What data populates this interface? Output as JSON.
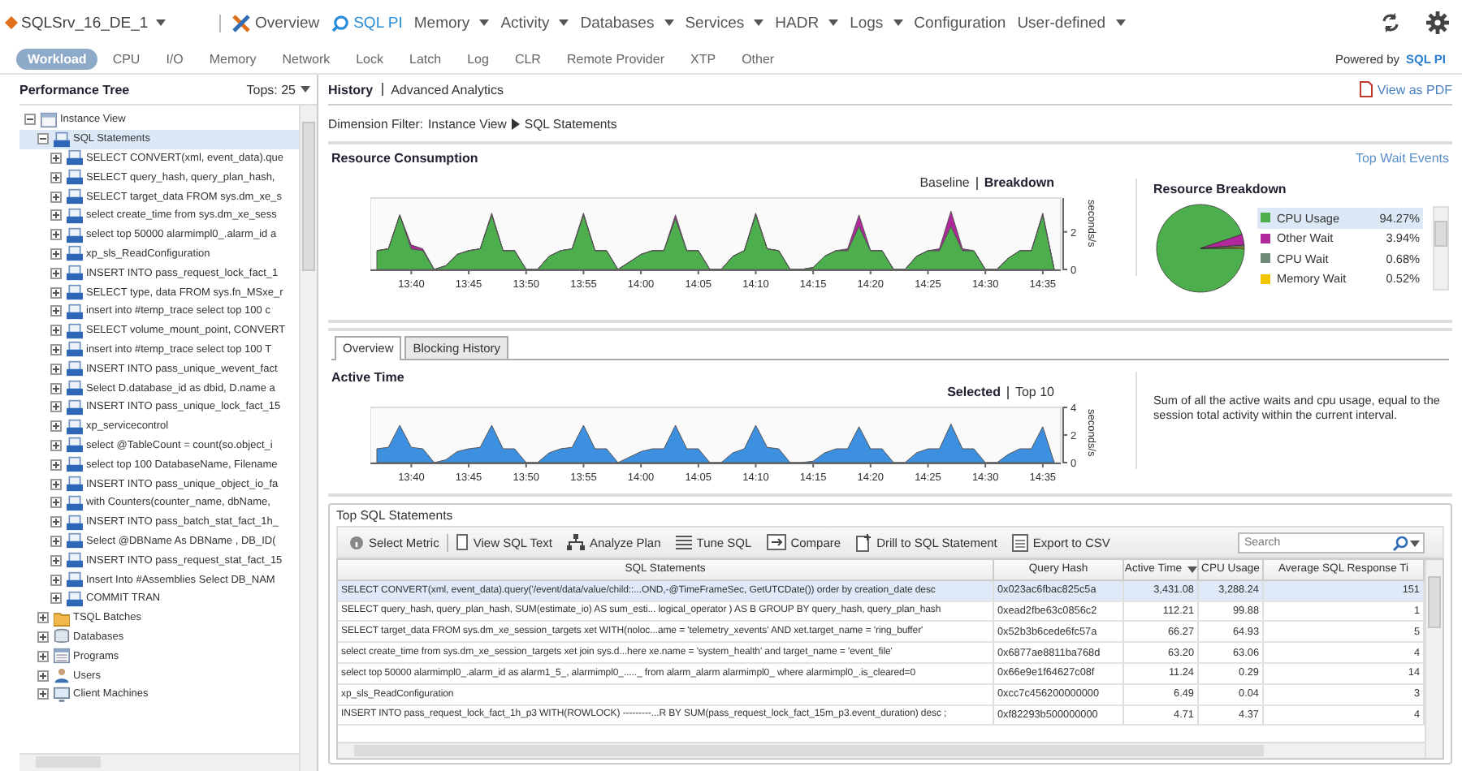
{
  "server": {
    "label": "SQLSrv_16_DE_1"
  },
  "nav": [
    {
      "label": "Overview",
      "kind": "overview",
      "dropdown": false,
      "selected": false
    },
    {
      "label": "SQL PI",
      "kind": "search",
      "dropdown": false,
      "selected": true
    },
    {
      "label": "Memory",
      "kind": "plain",
      "dropdown": true,
      "selected": false
    },
    {
      "label": "Activity",
      "kind": "plain",
      "dropdown": true,
      "selected": false
    },
    {
      "label": "Databases",
      "kind": "plain",
      "dropdown": true,
      "selected": false
    },
    {
      "label": "Services",
      "kind": "plain",
      "dropdown": true,
      "selected": false
    },
    {
      "label": "HADR",
      "kind": "plain",
      "dropdown": true,
      "selected": false
    },
    {
      "label": "Logs",
      "kind": "plain",
      "dropdown": true,
      "selected": false
    },
    {
      "label": "Configuration",
      "kind": "plain",
      "dropdown": false,
      "selected": false
    },
    {
      "label": "User-defined",
      "kind": "plain",
      "dropdown": true,
      "selected": false
    }
  ],
  "tabs": [
    {
      "label": "Workload",
      "selected": true
    },
    {
      "label": "CPU",
      "selected": false
    },
    {
      "label": "I/O",
      "selected": false
    },
    {
      "label": "Memory",
      "selected": false
    },
    {
      "label": "Network",
      "selected": false
    },
    {
      "label": "Lock",
      "selected": false
    },
    {
      "label": "Latch",
      "selected": false
    },
    {
      "label": "Log",
      "selected": false
    },
    {
      "label": "CLR",
      "selected": false
    },
    {
      "label": "Remote Provider",
      "selected": false
    },
    {
      "label": "XTP",
      "selected": false
    },
    {
      "label": "Other",
      "selected": false
    }
  ],
  "powered_by": {
    "label": "Powered by",
    "logo": "SQL PI"
  },
  "tree_panel": {
    "title": "Performance Tree",
    "tops": "Tops: 25"
  },
  "tree": [
    {
      "label": "Instance View",
      "kind": "instance",
      "expanded": true,
      "selected": false,
      "children": [
        {
          "label": "SQL Statements",
          "kind": "sql",
          "expanded": true,
          "selected": true,
          "children": [
            {
              "label": "SELECT CONVERT(xml, event_data).que",
              "kind": "sql",
              "expanded": false,
              "selected": false
            },
            {
              "label": "SELECT query_hash, query_plan_hash,",
              "kind": "sql",
              "expanded": false,
              "selected": false
            },
            {
              "label": "SELECT target_data FROM sys.dm_xe_s",
              "kind": "sql",
              "expanded": false,
              "selected": false
            },
            {
              "label": "select create_time from sys.dm_xe_sess",
              "kind": "sql",
              "expanded": false,
              "selected": false
            },
            {
              "label": "select top 50000 alarmimpl0_.alarm_id a",
              "kind": "sql",
              "expanded": false,
              "selected": false
            },
            {
              "label": "xp_sls_ReadConfiguration",
              "kind": "sql",
              "expanded": false,
              "selected": false
            },
            {
              "label": "INSERT INTO pass_request_lock_fact_1",
              "kind": "sql",
              "expanded": false,
              "selected": false
            },
            {
              "label": "SELECT type, data FROM sys.fn_MSxe_r",
              "kind": "sql",
              "expanded": false,
              "selected": false
            },
            {
              "label": "insert into #temp_trace select top 100 c",
              "kind": "sql",
              "expanded": false,
              "selected": false
            },
            {
              "label": "SELECT volume_mount_point, CONVERT",
              "kind": "sql",
              "expanded": false,
              "selected": false
            },
            {
              "label": "insert into #temp_trace select top 100 T",
              "kind": "sql",
              "expanded": false,
              "selected": false
            },
            {
              "label": "INSERT INTO pass_unique_wevent_fact",
              "kind": "sql",
              "expanded": false,
              "selected": false
            },
            {
              "label": "Select D.database_id as dbid, D.name a",
              "kind": "sql",
              "expanded": false,
              "selected": false
            },
            {
              "label": "INSERT INTO pass_unique_lock_fact_15",
              "kind": "sql",
              "expanded": false,
              "selected": false
            },
            {
              "label": "xp_servicecontrol",
              "kind": "sql",
              "expanded": false,
              "selected": false
            },
            {
              "label": "select @TableCount = count(so.object_i",
              "kind": "sql",
              "expanded": false,
              "selected": false
            },
            {
              "label": "select top 100 DatabaseName, Filename",
              "kind": "sql",
              "expanded": false,
              "selected": false
            },
            {
              "label": "INSERT INTO pass_unique_object_io_fa",
              "kind": "sql",
              "expanded": false,
              "selected": false
            },
            {
              "label": "with Counters(counter_name, dbName,",
              "kind": "sql",
              "expanded": false,
              "selected": false
            },
            {
              "label": "INSERT INTO pass_batch_stat_fact_1h_",
              "kind": "sql",
              "expanded": false,
              "selected": false
            },
            {
              "label": "Select @DBName As DBName , DB_ID(",
              "kind": "sql",
              "expanded": false,
              "selected": false
            },
            {
              "label": "INSERT INTO pass_request_stat_fact_15",
              "kind": "sql",
              "expanded": false,
              "selected": false
            },
            {
              "label": "Insert Into #Assemblies Select DB_NAM",
              "kind": "sql",
              "expanded": false,
              "selected": false
            },
            {
              "label": "COMMIT TRAN",
              "kind": "sql",
              "expanded": false,
              "selected": false
            }
          ]
        },
        {
          "label": "TSQL Batches",
          "kind": "batch",
          "expanded": false,
          "selected": false
        },
        {
          "label": "Databases",
          "kind": "database",
          "expanded": false,
          "selected": false
        },
        {
          "label": "Programs",
          "kind": "program",
          "expanded": false,
          "selected": false
        },
        {
          "label": "Users",
          "kind": "user",
          "expanded": false,
          "selected": false
        },
        {
          "label": "Client Machines",
          "kind": "machine",
          "expanded": false,
          "selected": false
        }
      ]
    }
  ],
  "view_tabs": [
    {
      "label": "History",
      "selected": true
    },
    {
      "label": "Advanced Analytics",
      "selected": false
    }
  ],
  "view_as_pdf": "View as PDF",
  "dimension_filter": {
    "label": "Dimension Filter:",
    "path": [
      "Instance View",
      "SQL Statements"
    ]
  },
  "resource_consumption": {
    "title": "Resource Consumption",
    "link": "Top Wait Events",
    "toggles": [
      {
        "label": "Baseline",
        "selected": false
      },
      {
        "label": "Breakdown",
        "selected": true
      }
    ],
    "chart_data": {
      "type": "area",
      "ylabel": "seconds/s",
      "stacked": true,
      "ylim": [
        0,
        3.8
      ],
      "yticks": [
        0,
        2
      ],
      "categories": [
        null,
        null,
        null,
        "13:40",
        null,
        null,
        null,
        null,
        "13:45",
        null,
        null,
        null,
        null,
        "13:50",
        null,
        null,
        null,
        null,
        "13:55",
        null,
        null,
        null,
        null,
        "14:00",
        null,
        null,
        null,
        null,
        "14:05",
        null,
        null,
        null,
        null,
        "14:10",
        null,
        null,
        null,
        null,
        "14:15",
        null,
        null,
        null,
        null,
        "14:20",
        null,
        null,
        null,
        null,
        "14:25",
        null,
        null,
        null,
        null,
        "14:30",
        null,
        null,
        null,
        null,
        "14:35",
        null
      ],
      "series": [
        {
          "color": "#4cae4c",
          "values": [
            1.0,
            1.1,
            2.9,
            1.1,
            1.0,
            0.0,
            0.2,
            0.8,
            1.0,
            1.1,
            2.9,
            1.0,
            1.0,
            0.0,
            0.0,
            0.7,
            1.0,
            1.1,
            2.9,
            1.0,
            1.0,
            0.0,
            0.4,
            0.8,
            1.0,
            1.0,
            2.7,
            1.0,
            1.0,
            0.0,
            0.0,
            0.7,
            1.0,
            2.9,
            1.1,
            1.0,
            0.0,
            0.0,
            0.1,
            0.7,
            1.0,
            1.0,
            2.3,
            1.0,
            1.0,
            0.0,
            0.0,
            0.7,
            1.0,
            1.0,
            2.3,
            1.0,
            1.0,
            0.0,
            0.0,
            0.6,
            1.0,
            1.0,
            2.9,
            0.0
          ]
        },
        {
          "color": "#b0289c",
          "values": [
            0,
            0,
            0,
            0.2,
            0.1,
            0,
            0,
            0,
            0,
            0,
            0.1,
            0,
            0,
            0,
            0,
            0,
            0,
            0,
            0.1,
            0,
            0,
            0,
            0,
            0,
            0,
            0,
            0.2,
            0,
            0,
            0,
            0,
            0,
            0,
            0.1,
            0,
            0,
            0,
            0,
            0,
            0,
            0,
            0.1,
            0.6,
            0,
            0,
            0,
            0,
            0,
            0,
            0.1,
            0.8,
            0.1,
            0,
            0,
            0,
            0,
            0,
            0,
            0.1,
            0
          ]
        }
      ]
    }
  },
  "resource_breakdown": {
    "title": "Resource Breakdown",
    "legend": [
      {
        "percent": "94.27%",
        "color": "#4cae4c",
        "selected": true
      },
      {
        "percent": "3.94%",
        "color": "#b0289c",
        "selected": false
      },
      {
        "percent": "0.68%",
        "color": "#6f8a78",
        "selected": false
      },
      {
        "percent": "0.52%",
        "color": "#f2c500",
        "selected": false
      }
    ],
    "chart_data": {
      "type": "pie",
      "categories": [
        "CPU Usage",
        "Other Wait",
        "CPU Wait",
        "Memory Wait"
      ],
      "values": [
        94.27,
        3.94,
        0.68,
        0.52
      ]
    }
  },
  "detail_tabs": [
    {
      "label": "Overview",
      "selected": true
    },
    {
      "label": "Blocking History",
      "selected": false
    }
  ],
  "active_time": {
    "title": "Active Time",
    "toggles": [
      {
        "label": "Selected",
        "selected": true
      },
      {
        "label": "Top 10",
        "selected": false
      }
    ],
    "description": "Sum of all the active waits and cpu usage, equal to the session total activity within the current interval.",
    "chart_data": {
      "type": "area",
      "ylabel": "seconds/s",
      "ylim": [
        0,
        4
      ],
      "yticks": [
        0,
        2,
        4
      ],
      "categories": [
        null,
        null,
        null,
        "13:40",
        null,
        null,
        null,
        null,
        "13:45",
        null,
        null,
        null,
        null,
        "13:50",
        null,
        null,
        null,
        null,
        "13:55",
        null,
        null,
        null,
        null,
        "14:00",
        null,
        null,
        null,
        null,
        "14:05",
        null,
        null,
        null,
        null,
        "14:10",
        null,
        null,
        null,
        null,
        "14:15",
        null,
        null,
        null,
        null,
        "14:20",
        null,
        null,
        null,
        null,
        "14:25",
        null,
        null,
        null,
        null,
        "14:30",
        null,
        null,
        null,
        null,
        "14:35",
        null
      ],
      "series": [
        {
          "color": "#3d8fe0",
          "values": [
            1.0,
            1.1,
            2.7,
            1.1,
            1.0,
            0.0,
            0.2,
            0.8,
            1.0,
            1.1,
            2.7,
            1.0,
            1.0,
            0.0,
            0.0,
            0.7,
            1.0,
            1.1,
            2.7,
            1.0,
            1.0,
            0.0,
            0.4,
            0.8,
            1.0,
            1.0,
            2.7,
            1.0,
            1.0,
            0.0,
            0.0,
            0.7,
            1.0,
            2.7,
            1.1,
            1.0,
            0.0,
            0.0,
            0.1,
            0.7,
            1.0,
            1.0,
            2.6,
            1.0,
            1.0,
            0.0,
            0.0,
            0.7,
            1.0,
            1.0,
            2.8,
            1.0,
            1.0,
            0.0,
            0.0,
            0.6,
            1.0,
            1.0,
            2.6,
            0.0
          ]
        }
      ]
    }
  },
  "top_sql": {
    "title": "Top SQL Statements",
    "toolbar": [
      {
        "label": "Select Metric",
        "kind": "metric"
      },
      {
        "label": "View SQL Text",
        "kind": "text"
      },
      {
        "label": "Analyze Plan",
        "kind": "plan"
      },
      {
        "label": "Tune SQL",
        "kind": "tune"
      },
      {
        "label": "Compare",
        "kind": "compare"
      },
      {
        "label": "Drill to SQL Statement",
        "kind": "drill"
      },
      {
        "label": "Export to CSV",
        "kind": "export"
      }
    ],
    "search": {
      "placeholder": "Search"
    },
    "columns": [
      {
        "label": "SQL Statements",
        "sorted": false
      },
      {
        "label": "Query Hash",
        "sorted": false
      },
      {
        "label": "Active Time",
        "sorted": true
      },
      {
        "label": "CPU Usage",
        "sorted": false
      },
      {
        "label": "Average SQL Response Ti",
        "sorted": false
      }
    ],
    "rows": [
      {
        "selected": true,
        "cells": [
          "SELECT CONVERT(xml, event_data).query('/event/data/value/child::...OND,-@TimeFrameSec, GetUTCDate()) order by creation_date desc",
          "0x023ac6fbac825c5a",
          "3,431.08",
          "3,288.24",
          "151"
        ]
      },
      {
        "selected": false,
        "cells": [
          "SELECT query_hash, query_plan_hash, SUM(estimate_io) AS sum_esti... logical_operator ) AS B GROUP BY query_hash, query_plan_hash",
          "0xead2fbe63c0856c2",
          "112.21",
          "99.88",
          "1"
        ]
      },
      {
        "selected": false,
        "cells": [
          "SELECT target_data FROM sys.dm_xe_session_targets xet WITH(noloc...ame = 'telemetry_xevents' AND xet.target_name = 'ring_buffer'",
          "0x52b3b6cede6fc57a",
          "66.27",
          "64.93",
          "5"
        ]
      },
      {
        "selected": false,
        "cells": [
          "select create_time from sys.dm_xe_session_targets xet join sys.d...here xe.name = 'system_health' and target_name = 'event_file'",
          "0x6877ae8811ba768d",
          "63.20",
          "63.06",
          "4"
        ]
      },
      {
        "selected": false,
        "cells": [
          "select top 50000 alarmimpl0_.alarm_id as alarm1_5_, alarmimpl0_....._ from alarm_alarm alarmimpl0_ where alarmimpl0_.is_cleared=0",
          "0x66e9e1f64627c08f",
          "11.24",
          "0.29",
          "14"
        ]
      },
      {
        "selected": false,
        "cells": [
          "xp_sls_ReadConfiguration",
          "0xcc7c456200000000",
          "6.49",
          "0.04",
          "3"
        ]
      },
      {
        "selected": false,
        "cells": [
          "INSERT INTO pass_request_lock_fact_1h_p3 WITH(ROWLOCK) ---------...R BY SUM(pass_request_lock_fact_15m_p3.event_duration) desc ;",
          "0xf82293b500000000",
          "4.71",
          "4.37",
          "4"
        ]
      }
    ]
  }
}
